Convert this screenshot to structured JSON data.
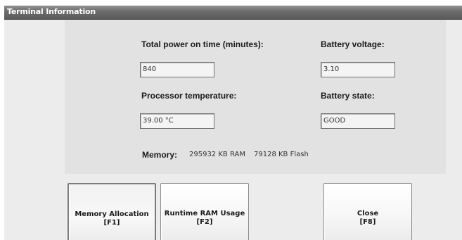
{
  "window": {
    "title": "Terminal Information"
  },
  "fields": {
    "power_on": {
      "label": "Total power on time (minutes):",
      "value": "840"
    },
    "battery_voltage": {
      "label": "Battery voltage:",
      "value": "3.10"
    },
    "processor_temp": {
      "label": "Processor temperature:",
      "value": "39.00 °C"
    },
    "battery_state": {
      "label": "Battery state:",
      "value": "GOOD"
    }
  },
  "memory": {
    "label": "Memory:",
    "ram": "295932 KB RAM",
    "flash": "79128 KB Flash"
  },
  "buttons": {
    "memory_allocation": {
      "label": "Memory Allocation",
      "key": "[F1]"
    },
    "runtime_ram": {
      "label": "Runtime RAM Usage",
      "key": "[F2]"
    },
    "close": {
      "label": "Close",
      "key": "[F8]"
    }
  }
}
